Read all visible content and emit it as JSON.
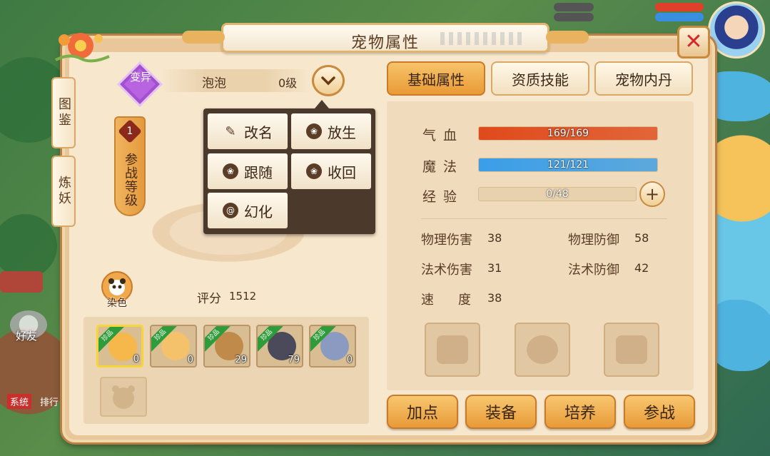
{
  "window": {
    "title": "宠物属性"
  },
  "side_tabs": [
    {
      "label": "图鉴"
    },
    {
      "label": "炼妖"
    }
  ],
  "pet": {
    "variant_badge": "变异",
    "name": "泡泡",
    "level": "0级",
    "battle_level_num": "1",
    "battle_level_label": "参战等级",
    "dye_label": "染色",
    "score_label": "评分",
    "score_value": "1512"
  },
  "action_menu": [
    {
      "label": "改名",
      "icon": "brush-icon"
    },
    {
      "label": "放生",
      "icon": "paw-icon"
    },
    {
      "label": "跟随",
      "icon": "paw-icon"
    },
    {
      "label": "收回",
      "icon": "paw-icon"
    },
    {
      "label": "幻化",
      "icon": "swirl-icon"
    }
  ],
  "pet_list": [
    {
      "tag": "珍品",
      "level": "0",
      "selected": true,
      "color": "#f6b84a"
    },
    {
      "tag": "珍品",
      "level": "0",
      "selected": false,
      "color": "#f3c26a"
    },
    {
      "tag": "珍品",
      "level": "29",
      "selected": false,
      "color": "#c08a4a"
    },
    {
      "tag": "珍品",
      "level": "79",
      "selected": false,
      "color": "#4a4a5a"
    },
    {
      "tag": "珍品",
      "level": "0",
      "selected": false,
      "color": "#8a9ac0"
    }
  ],
  "tabs": [
    {
      "label": "基础属性",
      "active": true
    },
    {
      "label": "资质技能",
      "active": false
    },
    {
      "label": "宠物内丹",
      "active": false
    }
  ],
  "stats": {
    "hp": {
      "label": "气血",
      "text": "169/169",
      "fraction": 1.0,
      "color": "#e04a1c"
    },
    "mp": {
      "label": "魔法",
      "text": "121/121",
      "fraction": 1.0,
      "color": "#3a9ee8"
    },
    "exp": {
      "label": "经验",
      "text": "0/48",
      "fraction": 0.0,
      "color": "#c9a56a"
    }
  },
  "attributes": {
    "phys_atk": {
      "label": "物理伤害",
      "value": "38"
    },
    "phys_def": {
      "label": "物理防御",
      "value": "58"
    },
    "magic_atk": {
      "label": "法术伤害",
      "value": "31"
    },
    "magic_def": {
      "label": "法术防御",
      "value": "42"
    },
    "speed": {
      "label": "速　度",
      "value": "38"
    }
  },
  "equip_slots": [
    "scroll-icon",
    "necklace-icon",
    "armor-icon"
  ],
  "action_buttons": [
    {
      "label": "加点"
    },
    {
      "label": "装备"
    },
    {
      "label": "培养"
    },
    {
      "label": "参战"
    }
  ],
  "hud": {
    "friends": "好友",
    "chat_system": "系统",
    "chat_rank": "排行"
  }
}
